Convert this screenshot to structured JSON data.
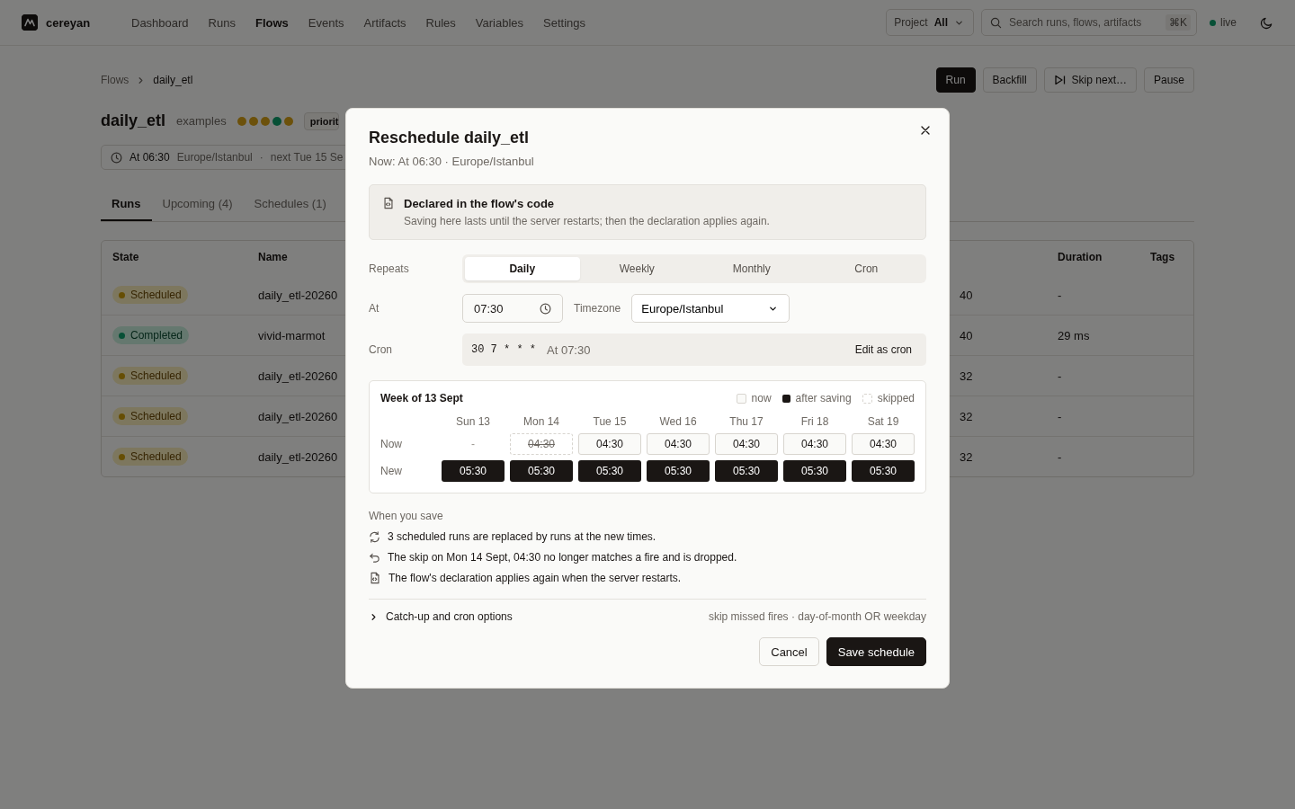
{
  "app": {
    "name": "cereyan"
  },
  "nav": [
    {
      "label": "Dashboard",
      "selected": false
    },
    {
      "label": "Runs",
      "selected": false
    },
    {
      "label": "Flows",
      "selected": true
    },
    {
      "label": "Events",
      "selected": false
    },
    {
      "label": "Artifacts",
      "selected": false
    },
    {
      "label": "Rules",
      "selected": false
    },
    {
      "label": "Variables",
      "selected": false
    },
    {
      "label": "Settings",
      "selected": false
    }
  ],
  "project": {
    "label": "Project",
    "value": "All"
  },
  "search": {
    "placeholder": "Search runs, flows, artifacts",
    "shortcut": "⌘K"
  },
  "live": {
    "label": "live"
  },
  "breadcrumb": [
    "Flows",
    "daily_etl"
  ],
  "actions": [
    {
      "label": "Run",
      "kind": "primary"
    },
    {
      "label": "Backfill",
      "kind": "plain"
    },
    {
      "label": "Skip next…",
      "kind": "skip"
    },
    {
      "label": "Pause",
      "kind": "plain"
    }
  ],
  "flow": {
    "title": "daily_etl",
    "project": "examples",
    "tag": "priorit",
    "run_dots": [
      {
        "kind": "scheduled"
      },
      {
        "kind": "scheduled"
      },
      {
        "kind": "scheduled"
      },
      {
        "kind": "completed"
      },
      {
        "kind": "scheduled"
      }
    ],
    "schedule": {
      "time": "At 06:30",
      "timezone": "Europe/Istanbul",
      "separator": "·",
      "next": "next Tue 15 Se"
    }
  },
  "tabs": [
    {
      "label": "Runs",
      "selected": true
    },
    {
      "label": "Upcoming (4)",
      "selected": false
    },
    {
      "label": "Schedules (1)",
      "selected": false
    }
  ],
  "table": {
    "columns": [
      "State",
      "Name",
      "Duration",
      "Tags"
    ],
    "rows": [
      {
        "state": "Scheduled",
        "kind": "scheduled",
        "name": "daily_etl-20260",
        "column_3": "40",
        "duration": "-"
      },
      {
        "state": "Completed",
        "kind": "completed",
        "name": "vivid-marmot",
        "column_3": "40",
        "duration": "29 ms"
      },
      {
        "state": "Scheduled",
        "kind": "scheduled",
        "name": "daily_etl-20260",
        "column_3": "32",
        "duration": "-"
      },
      {
        "state": "Scheduled",
        "kind": "scheduled",
        "name": "daily_etl-20260",
        "column_3": "32",
        "duration": "-"
      },
      {
        "state": "Scheduled",
        "kind": "scheduled",
        "name": "daily_etl-20260",
        "column_3": "32",
        "duration": "-"
      }
    ]
  },
  "dialog": {
    "title": "Reschedule daily_etl",
    "subtitle": "Now: At 06:30 · Europe/Istanbul",
    "notice": {
      "title": "Declared in the flow's code",
      "text": "Saving here lasts until the server restarts; then the declaration applies again."
    },
    "repeats": {
      "label": "Repeats",
      "options": [
        {
          "label": "Daily",
          "selected": true
        },
        {
          "label": "Weekly",
          "selected": false
        },
        {
          "label": "Monthly",
          "selected": false
        },
        {
          "label": "Cron",
          "selected": false
        }
      ]
    },
    "at": {
      "label": "At",
      "value": "07:30"
    },
    "timezone": {
      "label": "Timezone",
      "value": "Europe/Istanbul"
    },
    "cron": {
      "label": "Cron",
      "expression": "30 7 * * *",
      "description": "At 07:30",
      "action": "Edit as cron"
    },
    "week": {
      "title": "Week of 13 Sept",
      "legend": [
        {
          "label": "now",
          "kind": "now"
        },
        {
          "label": "after saving",
          "kind": "after"
        },
        {
          "label": "skipped",
          "kind": "skipped"
        }
      ],
      "row_labels": [
        "Now",
        "New"
      ],
      "days": [
        {
          "day": "Sun 13",
          "now": "-",
          "kind": "none",
          "new": "05:30"
        },
        {
          "day": "Mon 14",
          "now": "04:30",
          "kind": "skipped",
          "new": "05:30"
        },
        {
          "day": "Tue 15",
          "now": "04:30",
          "kind": "fire",
          "new": "05:30"
        },
        {
          "day": "Wed 16",
          "now": "04:30",
          "kind": "fire",
          "new": "05:30"
        },
        {
          "day": "Thu 17",
          "now": "04:30",
          "kind": "fire",
          "new": "05:30"
        },
        {
          "day": "Fri 18",
          "now": "04:30",
          "kind": "fire",
          "new": "05:30"
        },
        {
          "day": "Sat 19",
          "now": "04:30",
          "kind": "fire",
          "new": "05:30"
        }
      ]
    },
    "effects": {
      "title": "When you save",
      "items": [
        {
          "kind": "replace",
          "text": "3 scheduled runs are replaced by runs at the new times."
        },
        {
          "kind": "drop",
          "text": "The skip on Mon 14 Sept, 04:30 no longer matches a fire and is dropped."
        },
        {
          "kind": "declaration",
          "text": "The flow's declaration applies again when the server restarts."
        }
      ]
    },
    "options": {
      "label": "Catch-up and cron options",
      "expanded": false,
      "summary": "skip missed fires · day-of-month OR weekday"
    },
    "buttons": [
      {
        "label": "Cancel",
        "kind": "secondary"
      },
      {
        "label": "Save schedule",
        "kind": "primary"
      }
    ]
  }
}
